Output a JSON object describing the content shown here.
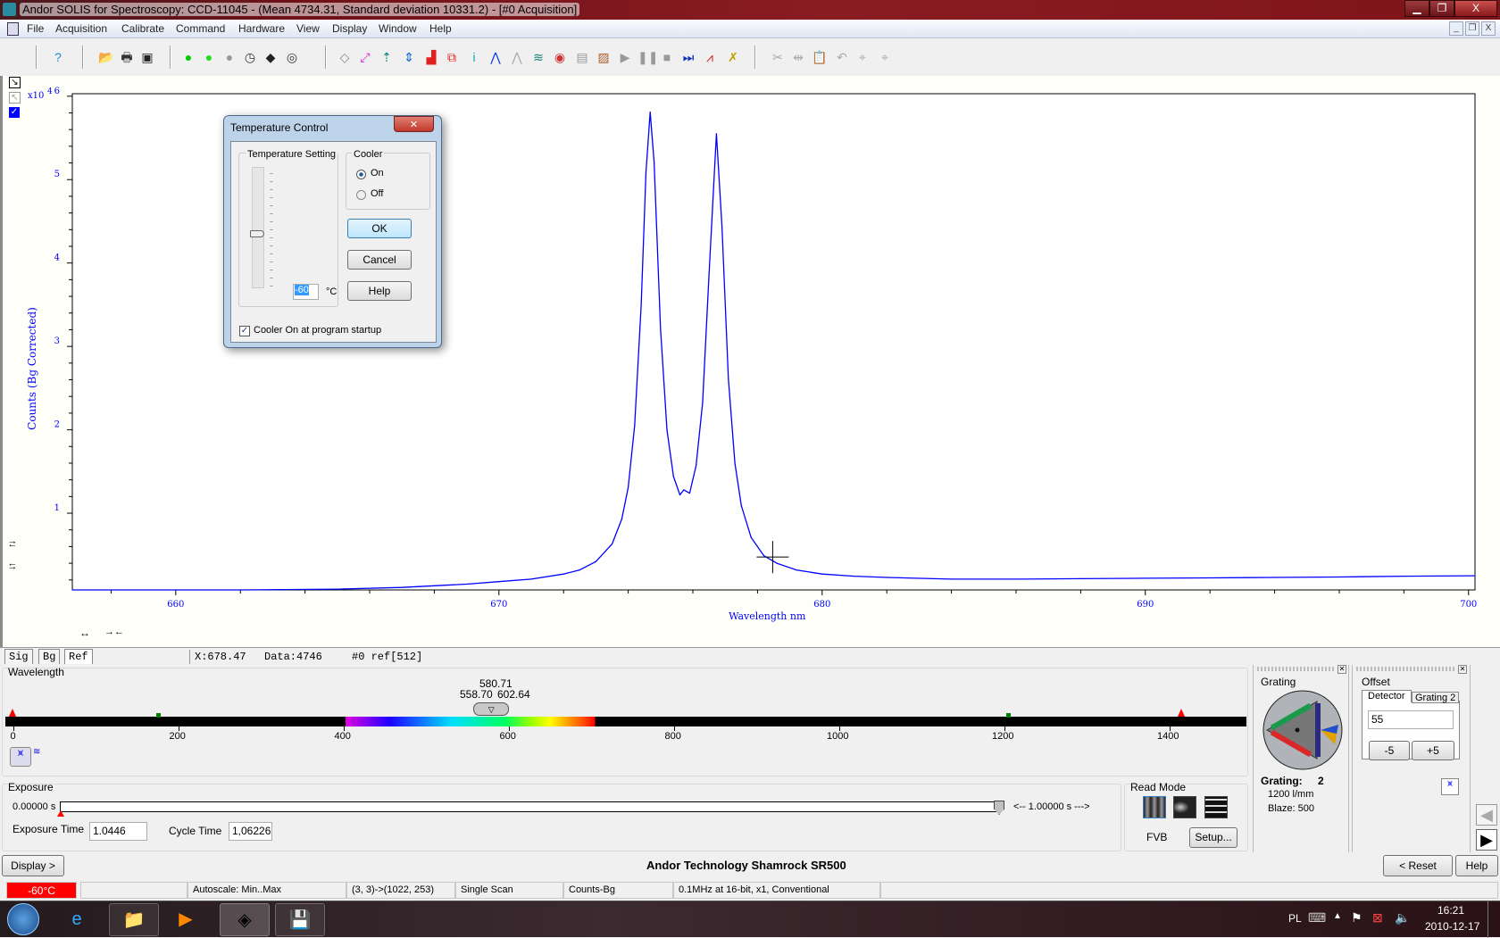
{
  "window": {
    "title": "Andor SOLIS for Spectroscopy: CCD-11045 - (Mean 4734.31, Standard deviation 10331.2) - [#0   Acquisition]",
    "min": "▁",
    "max": "❐",
    "close": "X"
  },
  "menu": [
    "File",
    "Acquisition",
    "Calibrate",
    "Command",
    "Hardware",
    "View",
    "Display",
    "Window",
    "Help"
  ],
  "mdi_buttons": {
    "min": "_",
    "restore": "❐",
    "close": "X"
  },
  "toolbar": [
    {
      "icon": "help-icon",
      "glyph": "?",
      "color": "#1a8ac7"
    },
    {
      "icon": "open-folder-icon",
      "glyph": "📂",
      "color": "#c8a000"
    },
    {
      "icon": "print-icon",
      "glyph": "🖶",
      "color": "#333"
    },
    {
      "icon": "save-icon",
      "glyph": "▣",
      "color": "#222"
    },
    {
      "icon": "run-realtime-icon",
      "glyph": "●",
      "color": "#00cc00"
    },
    {
      "icon": "take-signal-icon",
      "glyph": "●",
      "color": "#22dd22"
    },
    {
      "icon": "background-icon",
      "glyph": "●",
      "color": "#999"
    },
    {
      "icon": "timer-icon",
      "glyph": "◷",
      "color": "#333"
    },
    {
      "icon": "shutter-icon",
      "glyph": "◆",
      "color": "#222"
    },
    {
      "icon": "autofocus-icon",
      "glyph": "◎",
      "color": "#333"
    },
    {
      "icon": "select-region-icon",
      "glyph": "◇",
      "color": "#888"
    },
    {
      "icon": "zoom-expand-icon",
      "glyph": "⤢",
      "color": "#d020d0"
    },
    {
      "icon": "scale-up-icon",
      "glyph": "⇡",
      "color": "#108080"
    },
    {
      "icon": "scale-fit-icon",
      "glyph": "⇕",
      "color": "#1060d0"
    },
    {
      "icon": "histogram-icon",
      "glyph": "▟",
      "color": "#e02020"
    },
    {
      "icon": "regions-icon",
      "glyph": "⧉",
      "color": "#e02020"
    },
    {
      "icon": "info-icon",
      "glyph": "i",
      "color": "#0aa"
    },
    {
      "icon": "peak-icon",
      "glyph": "⋀",
      "color": "#1040e0"
    },
    {
      "icon": "peak-gray-icon",
      "glyph": "⋀",
      "color": "#aaa"
    },
    {
      "icon": "waterfall-icon",
      "glyph": "≋",
      "color": "#108070"
    },
    {
      "icon": "image-map-icon",
      "glyph": "◉",
      "color": "#d03030"
    },
    {
      "icon": "layout-icon",
      "glyph": "▤",
      "color": "#999"
    },
    {
      "icon": "portrait-icon",
      "glyph": "▨",
      "color": "#b06030"
    },
    {
      "icon": "play-icon",
      "glyph": "▶",
      "color": "#999"
    },
    {
      "icon": "pause-icon",
      "glyph": "❚❚",
      "color": "#999"
    },
    {
      "icon": "stop-icon",
      "glyph": "■",
      "color": "#999"
    },
    {
      "icon": "step-icon",
      "glyph": "⏭",
      "color": "#1030c0"
    },
    {
      "icon": "multi-peak-icon",
      "glyph": "⩘",
      "color": "#d02020"
    },
    {
      "icon": "tools-icon",
      "glyph": "✗",
      "color": "#c0a000"
    },
    {
      "icon": "cut-icon",
      "glyph": "✂",
      "color": "#aaa"
    },
    {
      "icon": "mirror-icon",
      "glyph": "⇹",
      "color": "#aaa"
    },
    {
      "icon": "paste-icon",
      "glyph": "📋",
      "color": "#aaa"
    },
    {
      "icon": "undo-icon",
      "glyph": "↶",
      "color": "#aaa"
    },
    {
      "icon": "marker-icon",
      "glyph": "⌖",
      "color": "#aaa"
    },
    {
      "icon": "marker2-icon",
      "glyph": "⌖",
      "color": "#aaa"
    }
  ],
  "chart_data": {
    "type": "line",
    "title": "",
    "xlabel": "Wavelength nm",
    "ylabel": "Counts (Bg Corrected)",
    "y_multiplier": "x10",
    "y_multiplier_exp": "4",
    "xlim": [
      656.8,
      700.2
    ],
    "ylim": [
      800,
      60300
    ],
    "x_ticks": [
      660,
      670,
      680,
      690,
      700
    ],
    "x_tick_labels": [
      "660",
      "670",
      "680",
      "690",
      "700"
    ],
    "y_ticks": [
      10000,
      20000,
      30000,
      40000,
      50000,
      60000
    ],
    "y_tick_labels": [
      "1",
      "2",
      "3",
      "4",
      "5",
      "6"
    ],
    "grid": false,
    "color": "#0000ff",
    "cursor": {
      "x": 678.47,
      "y": 4746
    },
    "series": [
      {
        "x": [
          656.8,
          662,
          665,
          667,
          669,
          670,
          671,
          672,
          672.5,
          673,
          673.5,
          673.8,
          674.0,
          674.2,
          674.4,
          674.55,
          674.68,
          674.8,
          675.0,
          675.2,
          675.4,
          675.6,
          675.72,
          675.9,
          676.1,
          676.3,
          676.5,
          676.73,
          676.9,
          677.1,
          677.3,
          677.5,
          677.8,
          678.2,
          678.6,
          679.2,
          680,
          681,
          682,
          684,
          686,
          688,
          690,
          692,
          694,
          696,
          698,
          700.2
        ],
        "y": [
          800,
          800,
          900,
          1100,
          1500,
          1800,
          2100,
          2700,
          3200,
          4200,
          6300,
          9300,
          13100,
          20500,
          34900,
          50900,
          58100,
          52100,
          32100,
          20000,
          14400,
          12200,
          12800,
          12400,
          15700,
          23200,
          38600,
          55500,
          44400,
          26100,
          16000,
          10900,
          7100,
          4900,
          4000,
          3200,
          2700,
          2450,
          2300,
          2100,
          2100,
          2150,
          2200,
          2250,
          2300,
          2350,
          2450,
          2500
        ]
      }
    ]
  },
  "chart_side": {
    "zoom_out": "↘",
    "zoom_in": "↖",
    "check": "✓",
    "y_expand": "↑↓",
    "y_shrink": "↓↑",
    "x_expand": "↔",
    "x_shrink": "→←"
  },
  "tabs": [
    "Sig",
    "Bg",
    "Ref"
  ],
  "readout": {
    "x": "X:678.47",
    "data": "Data:4746",
    "ref": "#0 ref[512]"
  },
  "wavelength": {
    "title": "Wavelength",
    "center": "580.71",
    "low": "558.70",
    "high": "602.64",
    "ticks": [
      "0",
      "200",
      "400",
      "600",
      "800",
      "1000",
      "1200",
      "1400"
    ],
    "center_value": 580.71
  },
  "exposure": {
    "title": "Exposure",
    "min_label": "0.00000 s",
    "max_label": "<-- 1.00000 s --->",
    "exposure_time_label": "Exposure Time",
    "exposure_time": "1.0446",
    "cycle_time_label": "Cycle Time",
    "cycle_time": "1,06226"
  },
  "read_mode": {
    "title": "Read Mode",
    "mode": "FVB",
    "setup": "Setup..."
  },
  "grating": {
    "title": "Grating",
    "label": "Grating:",
    "number": "2",
    "lines": "1200 l/mm",
    "blaze": "Blaze: 500"
  },
  "offset": {
    "title": "Offset",
    "tabs": [
      "Detector",
      "Grating 2"
    ],
    "value": "55",
    "minus": "-5",
    "plus": "+5"
  },
  "footer": {
    "display": "Display >",
    "device": "Andor Technology Shamrock SR500",
    "reset": "< Reset",
    "help": "Help"
  },
  "statusbar": {
    "temp": "-60°C",
    "temp_color": "#ff0000",
    "autoscale": "Autoscale: Min..Max",
    "region": "(3, 3)->(1022, 253)",
    "mode": "Single Scan",
    "units": "Counts-Bg",
    "readout": "0.1MHz at 16-bit, x1, Conventional"
  },
  "dialog": {
    "title": "Temperature Control",
    "setting_group": "Temperature Setting",
    "value": "-60",
    "unit": "°C",
    "slider_fraction": 0.45,
    "cooler_group": "Cooler",
    "on": "On",
    "off": "Off",
    "ok": "OK",
    "cancel": "Cancel",
    "help": "Help",
    "startup": "Cooler On at program startup",
    "close": "✕"
  },
  "taskbar": {
    "lang": "PL",
    "time": "16:21",
    "date": "2010-12-17"
  }
}
